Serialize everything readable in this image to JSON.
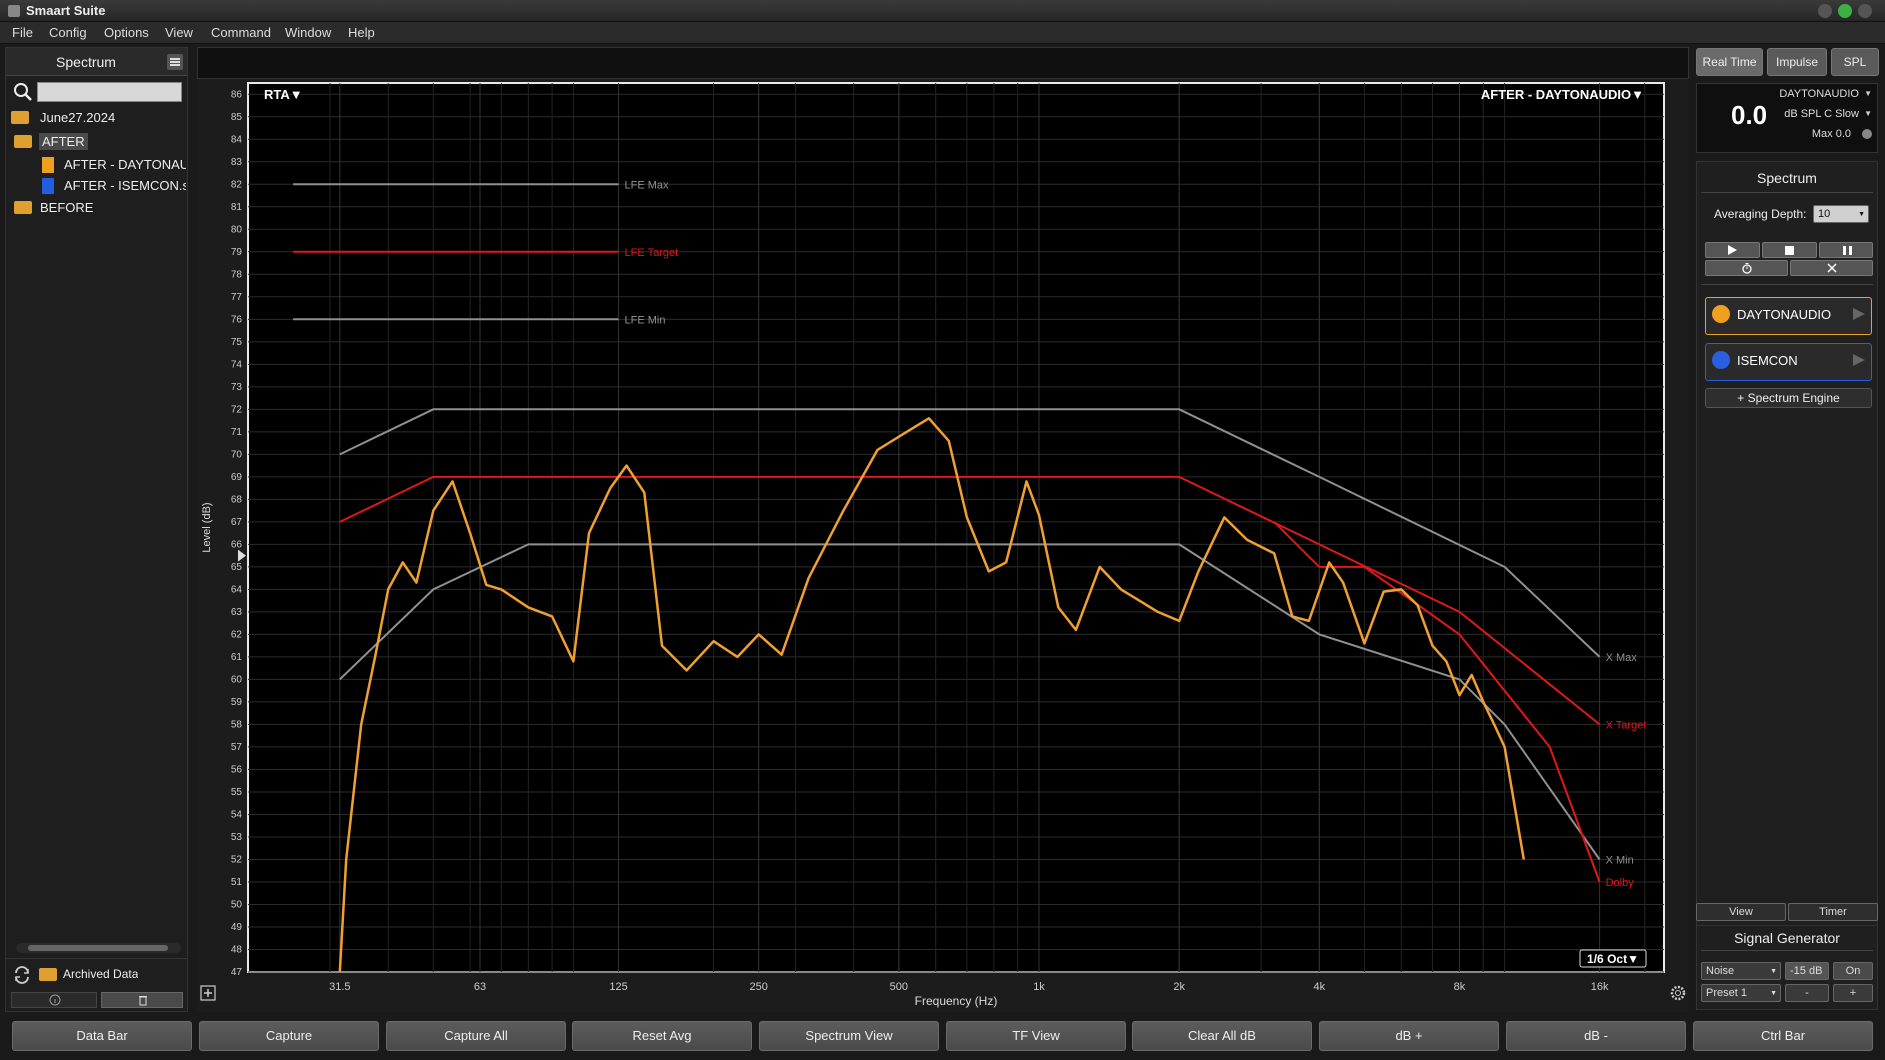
{
  "window": {
    "title": "Smaart Suite"
  },
  "menu": [
    "File",
    "Config",
    "Options",
    "View",
    "Command",
    "Window",
    "Help"
  ],
  "sidebar": {
    "title": "Spectrum",
    "search_placeholder": "",
    "tree": [
      {
        "label": "June27.2024",
        "type": "folder"
      },
      {
        "label": "AFTER",
        "type": "folder",
        "selected": true
      },
      {
        "label": "AFTER - DAYTONAUDIO",
        "type": "file",
        "color": "#f0a020"
      },
      {
        "label": "AFTER - ISEMCON.s",
        "type": "file",
        "color": "#2060e0"
      },
      {
        "label": "BEFORE",
        "type": "folder"
      }
    ],
    "archived_label": "Archived Data"
  },
  "plot": {
    "mode_label": "RTA▼",
    "measurement_label": "AFTER - DAYTONAUDIO▼",
    "resolution_label": "1/6 Oct▼"
  },
  "right": {
    "tabs": [
      "Real Time",
      "Impulse",
      "SPL"
    ],
    "spl": {
      "source": "DAYTONAUDIO",
      "value": "0.0",
      "unit": "dB SPL C Slow",
      "max": "Max 0.0"
    },
    "spectrum_title": "Spectrum",
    "averaging_label": "Averaging Depth:",
    "averaging_value": "10",
    "measurements": [
      {
        "label": "DAYTONAUDIO",
        "color": "#f0a020"
      },
      {
        "label": "ISEMCON",
        "color": "#2a5fe0"
      }
    ],
    "engine_label": "+ Spectrum Engine",
    "view_label": "View",
    "timer_label": "Timer",
    "siggen_title": "Signal Generator",
    "noise_label": "Noise",
    "level_label": "-15 dB",
    "on_label": "On",
    "preset_label": "Preset 1",
    "minus_label": "-",
    "plus_label": "+"
  },
  "bottom_buttons": [
    "Data Bar",
    "Capture",
    "Capture All",
    "Reset Avg",
    "Spectrum View",
    "TF View",
    "Clear All dB",
    "dB +",
    "dB -",
    "Ctrl Bar"
  ],
  "colors": {
    "trace": "#f0a030",
    "target": "#e01818",
    "limit": "#909090",
    "grid": "#2c2c2c"
  },
  "chart_data": {
    "type": "line",
    "xlabel": "Frequency (Hz)",
    "ylabel": "Level (dB)",
    "xscale": "log",
    "xlim": [
      20,
      22000
    ],
    "ylim": [
      47,
      86.5
    ],
    "xticks": [
      {
        "v": 31.5,
        "label": "31.5"
      },
      {
        "v": 63,
        "label": "63"
      },
      {
        "v": 125,
        "label": "125"
      },
      {
        "v": 250,
        "label": "250"
      },
      {
        "v": 500,
        "label": "500"
      },
      {
        "v": 1000,
        "label": "1k"
      },
      {
        "v": 2000,
        "label": "2k"
      },
      {
        "v": 4000,
        "label": "4k"
      },
      {
        "v": 8000,
        "label": "8k"
      },
      {
        "v": 16000,
        "label": "16k"
      }
    ],
    "yticks": [
      47,
      48,
      49,
      50,
      51,
      52,
      53,
      54,
      55,
      56,
      57,
      58,
      59,
      60,
      61,
      62,
      63,
      64,
      65,
      66,
      67,
      68,
      69,
      70,
      71,
      72,
      73,
      74,
      75,
      76,
      77,
      78,
      79,
      80,
      81,
      82,
      83,
      84,
      85,
      86
    ],
    "series": [
      {
        "name": "LFE Max",
        "color": "#909090",
        "points": [
          [
            25,
            82
          ],
          [
            125,
            82
          ]
        ]
      },
      {
        "name": "LFE Target",
        "color": "#e01818",
        "points": [
          [
            25,
            79
          ],
          [
            125,
            79
          ]
        ]
      },
      {
        "name": "LFE Min",
        "color": "#909090",
        "points": [
          [
            25,
            76
          ],
          [
            125,
            76
          ]
        ]
      },
      {
        "name": "X Max",
        "color": "#909090",
        "points": [
          [
            31.5,
            70
          ],
          [
            50,
            72
          ],
          [
            2000,
            72
          ],
          [
            4000,
            69
          ],
          [
            10000,
            65
          ],
          [
            16000,
            61
          ]
        ]
      },
      {
        "name": "X Min",
        "color": "#909090",
        "points": [
          [
            31.5,
            60
          ],
          [
            50,
            64
          ],
          [
            80,
            66
          ],
          [
            2000,
            66
          ],
          [
            4000,
            62
          ],
          [
            8000,
            60
          ],
          [
            10000,
            58
          ],
          [
            16000,
            52
          ]
        ]
      },
      {
        "name": "X Target",
        "color": "#e01818",
        "points": [
          [
            31.5,
            67
          ],
          [
            50,
            69
          ],
          [
            2000,
            69
          ],
          [
            4000,
            66
          ],
          [
            8000,
            63
          ],
          [
            16000,
            58
          ]
        ]
      },
      {
        "name": "Dolby",
        "color": "#e01818",
        "points": [
          [
            3200,
            67
          ],
          [
            4000,
            65
          ],
          [
            5000,
            65
          ],
          [
            8000,
            62
          ],
          [
            12500,
            57
          ],
          [
            16000,
            51
          ]
        ]
      },
      {
        "name": "",
        "color": "#f0a030",
        "points": [
          [
            31.5,
            47
          ],
          [
            32.5,
            52
          ],
          [
            35,
            58
          ],
          [
            37.5,
            61
          ],
          [
            40,
            64
          ],
          [
            43,
            65.2
          ],
          [
            46,
            64.3
          ],
          [
            50,
            67.5
          ],
          [
            55,
            68.8
          ],
          [
            60,
            66.5
          ],
          [
            65,
            64.2
          ],
          [
            70,
            64
          ],
          [
            80,
            63.2
          ],
          [
            90,
            62.8
          ],
          [
            100,
            60.8
          ],
          [
            108,
            66.5
          ],
          [
            120,
            68.5
          ],
          [
            130,
            69.5
          ],
          [
            142,
            68.3
          ],
          [
            155,
            61.5
          ],
          [
            175,
            60.4
          ],
          [
            200,
            61.7
          ],
          [
            225,
            61
          ],
          [
            250,
            62
          ],
          [
            280,
            61.1
          ],
          [
            320,
            64.5
          ],
          [
            380,
            67.5
          ],
          [
            450,
            70.2
          ],
          [
            520,
            71
          ],
          [
            580,
            71.6
          ],
          [
            640,
            70.6
          ],
          [
            700,
            67.2
          ],
          [
            780,
            64.8
          ],
          [
            850,
            65.2
          ],
          [
            940,
            68.8
          ],
          [
            1000,
            67.3
          ],
          [
            1100,
            63.2
          ],
          [
            1200,
            62.2
          ],
          [
            1350,
            65
          ],
          [
            1500,
            64
          ],
          [
            1800,
            63
          ],
          [
            2000,
            62.6
          ],
          [
            2200,
            64.8
          ],
          [
            2500,
            67.2
          ],
          [
            2800,
            66.2
          ],
          [
            3200,
            65.6
          ],
          [
            3500,
            62.8
          ],
          [
            3800,
            62.6
          ],
          [
            4200,
            65.2
          ],
          [
            4500,
            64.3
          ],
          [
            5000,
            61.6
          ],
          [
            5500,
            63.9
          ],
          [
            6000,
            64
          ],
          [
            6500,
            63.3
          ],
          [
            7000,
            61.5
          ],
          [
            7500,
            60.8
          ],
          [
            8000,
            59.3
          ],
          [
            8500,
            60.2
          ],
          [
            9000,
            59
          ],
          [
            9500,
            58
          ],
          [
            10000,
            57
          ],
          [
            11000,
            52
          ]
        ]
      }
    ]
  }
}
